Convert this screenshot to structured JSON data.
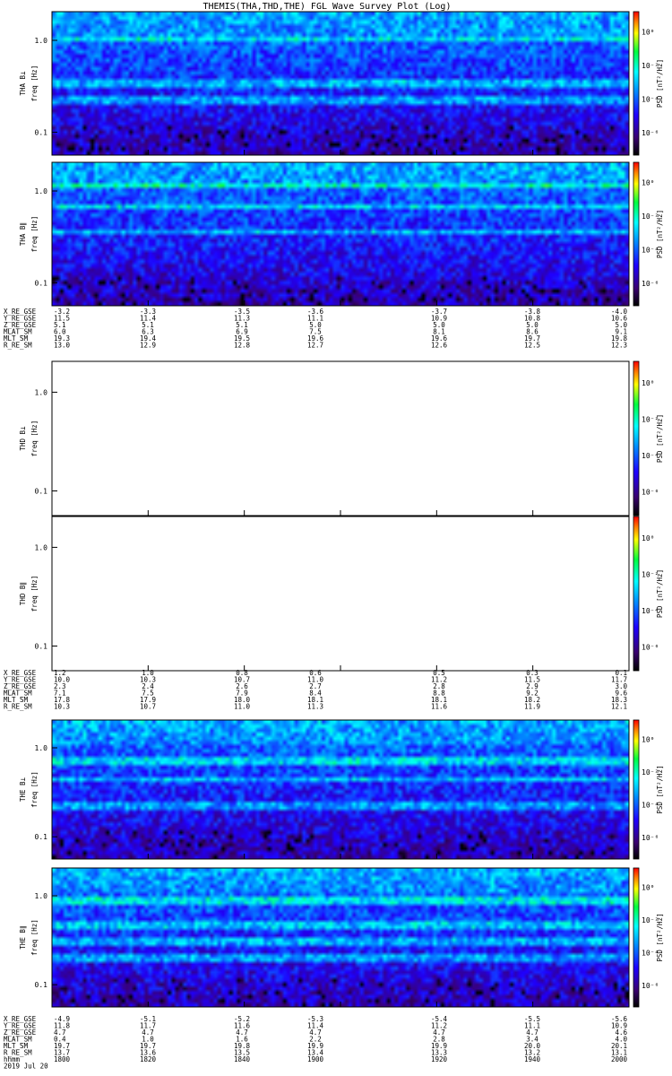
{
  "chart_data": {
    "type": "heatmap",
    "title": "THEMIS(THA,THD,THE) FGL Wave Survey Plot (Log)",
    "ylabel": "freq [Hz]",
    "ytick_labels": [
      "1.0",
      "0.1"
    ],
    "colorbar_label": "PSD [nT²/Hz]",
    "colorbar_ticks": [
      "10⁰",
      "10⁻²",
      "10⁻⁴",
      "10⁻⁶"
    ],
    "panels": [
      {
        "label": "THA B⊥",
        "has_data": true,
        "bands": [
          0.18,
          0.5,
          0.62
        ]
      },
      {
        "label": "THA B∥",
        "has_data": true,
        "bands": [
          0.15,
          0.3,
          0.48
        ]
      },
      {
        "label": "THD B⊥",
        "has_data": false,
        "bands": []
      },
      {
        "label": "THD B∥",
        "has_data": false,
        "bands": []
      },
      {
        "label": "THE B⊥",
        "has_data": true,
        "bands": [
          0.28,
          0.42,
          0.62
        ]
      },
      {
        "label": "THE B∥",
        "has_data": true,
        "bands": [
          0.22,
          0.4,
          0.53,
          0.65
        ]
      }
    ],
    "ephemeris": [
      {
        "rows": [
          {
            "name": "X_RE_GSE",
            "values": [
              "-3.2",
              "-3.3",
              "-3.5",
              "-3.6",
              "-3.7",
              "-3.8",
              "-4.0"
            ]
          },
          {
            "name": "Y_RE_GSE",
            "values": [
              "11.5",
              "11.4",
              "11.3",
              "11.1",
              "10.9",
              "10.8",
              "10.6"
            ]
          },
          {
            "name": "Z_RE_GSE",
            "values": [
              "5.1",
              "5.1",
              "5.1",
              "5.0",
              "5.0",
              "5.0",
              "5.0"
            ]
          },
          {
            "name": "MLAT_SM",
            "values": [
              "6.0",
              "6.3",
              "6.9",
              "7.5",
              "8.1",
              "8.6",
              "9.1"
            ]
          },
          {
            "name": "MLT_SM",
            "values": [
              "19.3",
              "19.4",
              "19.5",
              "19.6",
              "19.6",
              "19.7",
              "19.8"
            ]
          },
          {
            "name": "R_RE_SM",
            "values": [
              "13.0",
              "12.9",
              "12.8",
              "12.7",
              "12.6",
              "12.5",
              "12.3"
            ]
          }
        ]
      },
      {
        "rows": [
          {
            "name": "X_RE_GSE",
            "values": [
              "1.2",
              "1.0",
              "0.8",
              "0.6",
              "0.5",
              "0.3",
              "0.1"
            ]
          },
          {
            "name": "Y_RE_GSE",
            "values": [
              "10.0",
              "10.3",
              "10.7",
              "11.0",
              "11.2",
              "11.5",
              "11.7"
            ]
          },
          {
            "name": "Z_RE_GSE",
            "values": [
              "2.3",
              "2.4",
              "2.6",
              "2.7",
              "2.8",
              "2.9",
              "3.0"
            ]
          },
          {
            "name": "MLAT_SM",
            "values": [
              "7.1",
              "7.5",
              "7.9",
              "8.4",
              "8.8",
              "9.2",
              "9.6"
            ]
          },
          {
            "name": "MLT_SM",
            "values": [
              "17.8",
              "17.9",
              "18.0",
              "18.1",
              "18.1",
              "18.2",
              "18.3"
            ]
          },
          {
            "name": "R_RE_SM",
            "values": [
              "10.3",
              "10.7",
              "11.0",
              "11.3",
              "11.6",
              "11.9",
              "12.1"
            ]
          }
        ]
      },
      {
        "rows": [
          {
            "name": "X_RE_GSE",
            "values": [
              "-4.9",
              "-5.1",
              "-5.2",
              "-5.3",
              "-5.4",
              "-5.5",
              "-5.6"
            ]
          },
          {
            "name": "Y_RE_GSE",
            "values": [
              "11.8",
              "11.7",
              "11.6",
              "11.4",
              "11.2",
              "11.1",
              "10.9"
            ]
          },
          {
            "name": "Z_RE_GSE",
            "values": [
              "4.7",
              "4.7",
              "4.7",
              "4.7",
              "4.7",
              "4.7",
              "4.6"
            ]
          },
          {
            "name": "MLAT_SM",
            "values": [
              "0.4",
              "1.0",
              "1.6",
              "2.2",
              "2.8",
              "3.4",
              "4.0"
            ]
          },
          {
            "name": "MLT_SM",
            "values": [
              "19.7",
              "19.7",
              "19.8",
              "19.9",
              "19.9",
              "20.0",
              "20.1"
            ]
          },
          {
            "name": "R_RE_SM",
            "values": [
              "13.7",
              "13.6",
              "13.5",
              "13.4",
              "13.3",
              "13.2",
              "13.1"
            ]
          },
          {
            "name": "hhmm",
            "values": [
              "1800",
              "1820",
              "1840",
              "1900",
              "1920",
              "1940",
              "2000"
            ]
          }
        ],
        "date": "2019 Jul 20"
      }
    ]
  }
}
